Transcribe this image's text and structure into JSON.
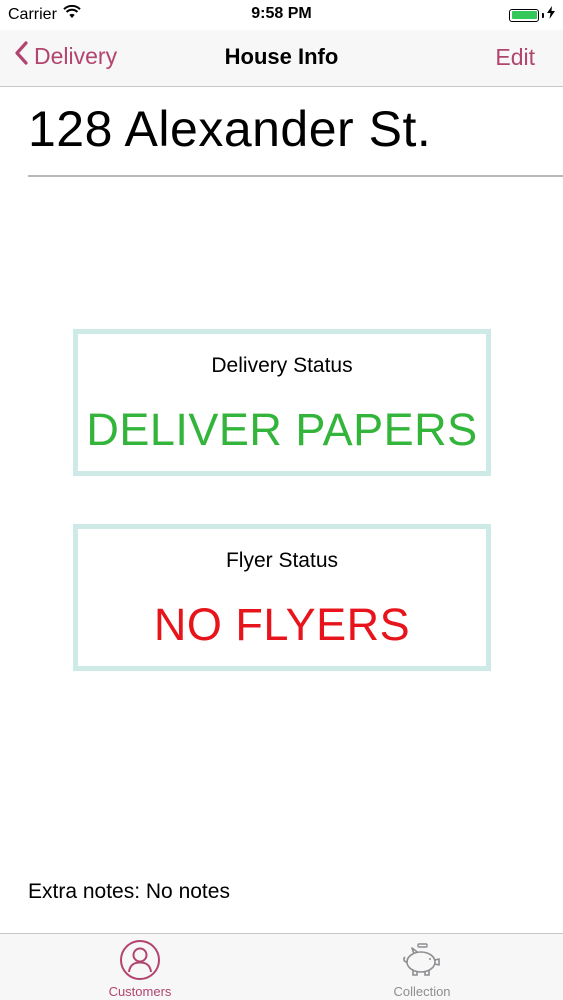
{
  "status_bar": {
    "carrier": "Carrier",
    "time": "9:58 PM",
    "icons": [
      "wifi-icon",
      "battery-icon",
      "charging-bolt-icon"
    ]
  },
  "nav": {
    "back_label": "Delivery",
    "title": "House Info",
    "edit_label": "Edit"
  },
  "house": {
    "address": "128 Alexander St."
  },
  "delivery": {
    "label": "Delivery Status",
    "value": "DELIVER PAPERS"
  },
  "flyer": {
    "label": "Flyer Status",
    "value": "NO FLYERS"
  },
  "notes": {
    "text": "Extra notes: No notes"
  },
  "tabs": [
    {
      "label": "Customers",
      "icon": "person-icon",
      "selected": true
    },
    {
      "label": "Collection",
      "icon": "piggy-bank-icon",
      "selected": false
    }
  ],
  "colors": {
    "accent": "#b1456f",
    "deliver_green": "#33b43a",
    "no_flyers_red": "#e8141c",
    "box_border": "#cdeae6",
    "battery_green": "#34c759"
  }
}
